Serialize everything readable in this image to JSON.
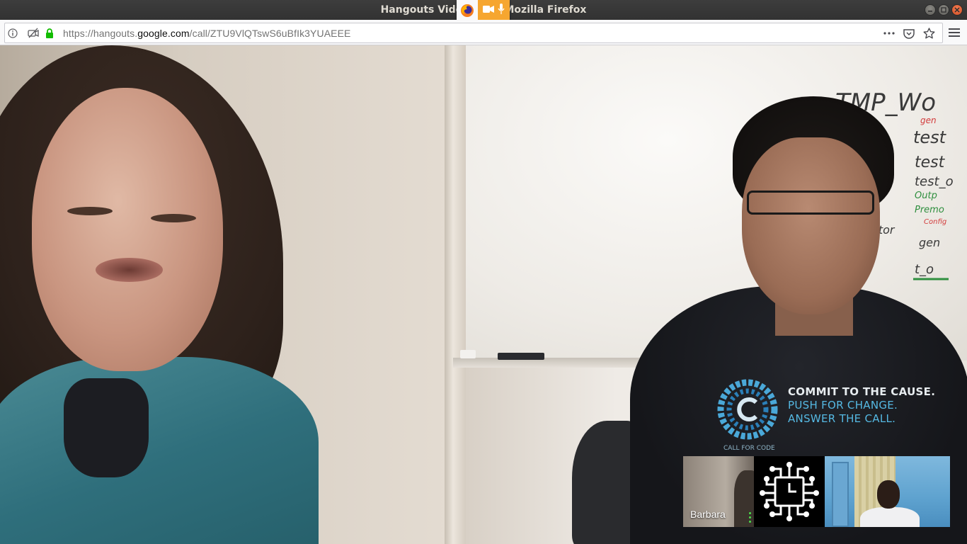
{
  "window": {
    "title": "Hangouts Video Call - Mozilla Firefox"
  },
  "sharing_indicator": {
    "icons": [
      "firefox-icon",
      "camera-icon",
      "microphone-icon"
    ],
    "accent_color": "#f6a630"
  },
  "browser": {
    "url_prefix": "https://hangouts.",
    "url_domain": "google.com",
    "url_path": "/call/ZTU9VlQTswS6uBfIk3YUAEEE",
    "icons": [
      "info-icon",
      "permissions-icon",
      "lock-icon",
      "page-actions-icon",
      "pocket-icon",
      "bookmark-star-icon",
      "hamburger-menu-icon"
    ]
  },
  "call": {
    "main_speakers": [
      "woman-participant",
      "man-participant"
    ],
    "shirt_text": {
      "line1": "COMMIT TO THE CAUSE.",
      "line2": "PUSH FOR CHANGE.",
      "line3": "ANSWER THE CALL."
    },
    "shirt_logo_label": "CALL FOR CODE",
    "whiteboard_lines": [
      "TMP_Wo",
      "gen",
      "test",
      "test",
      "test_o",
      "Outp",
      "Premo",
      "Config",
      "lidator",
      "gen",
      "t_o"
    ],
    "participants": [
      {
        "name": "Barbara",
        "speaking": true
      },
      {
        "name": "",
        "avatar": "circuit-clock-logo"
      },
      {
        "name": ""
      }
    ]
  }
}
